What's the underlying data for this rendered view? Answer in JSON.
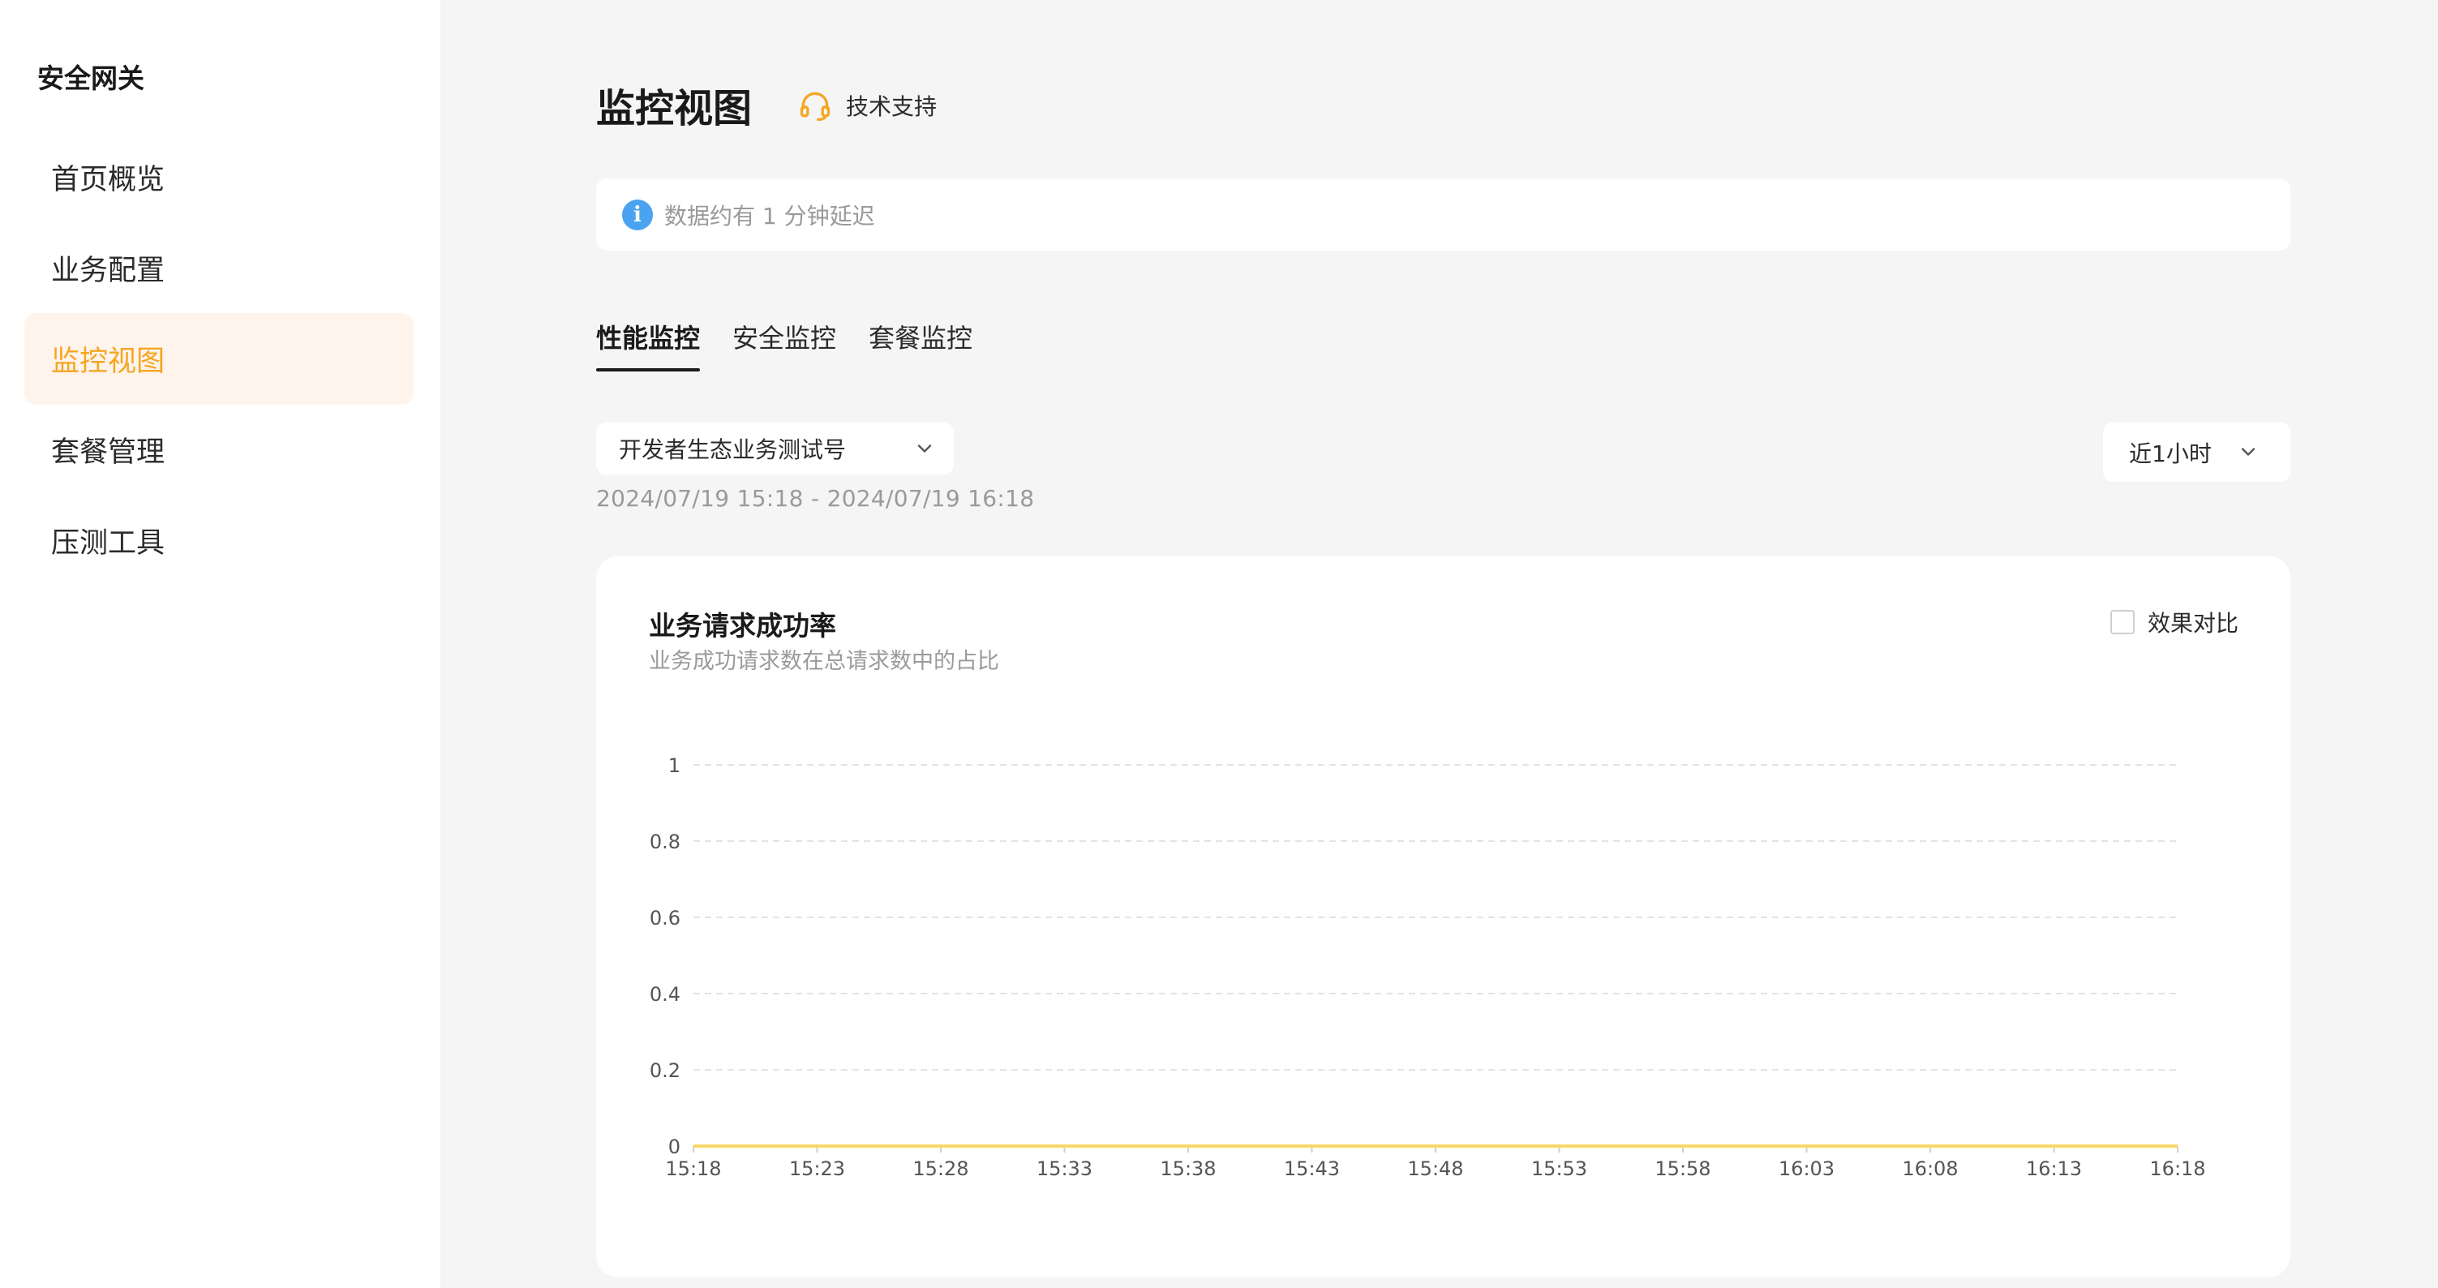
{
  "sidebar": {
    "title": "安全网关",
    "items": [
      {
        "label": "首页概览",
        "active": false
      },
      {
        "label": "业务配置",
        "active": false
      },
      {
        "label": "监控视图",
        "active": true
      },
      {
        "label": "套餐管理",
        "active": false
      },
      {
        "label": "压测工具",
        "active": false
      }
    ]
  },
  "header": {
    "title": "监控视图",
    "support_label": "技术支持",
    "support_icon": "headset-icon"
  },
  "notice": {
    "icon": "info-icon",
    "text": "数据约有 1 分钟延迟"
  },
  "tabs": [
    {
      "label": "性能监控",
      "active": true
    },
    {
      "label": "安全监控",
      "active": false
    },
    {
      "label": "套餐监控",
      "active": false
    }
  ],
  "filters": {
    "account_value": "开发者生态业务测试号",
    "time_range_text": "2024/07/19 15:18 - 2024/07/19 16:18",
    "period_value": "近1小时"
  },
  "card": {
    "title": "业务请求成功率",
    "subtitle": "业务成功请求数在总请求数中的占比",
    "compare_label": "效果对比",
    "compare_checked": false
  },
  "colors": {
    "accent": "#f5a623",
    "active_nav_bg": "#fff4ec",
    "info": "#4aa3f0",
    "series_line": "#f6d96a"
  },
  "chart_data": {
    "type": "line",
    "x": [
      "15:18",
      "15:23",
      "15:28",
      "15:33",
      "15:38",
      "15:43",
      "15:48",
      "15:53",
      "15:58",
      "16:03",
      "16:08",
      "16:13",
      "16:18"
    ],
    "series": [
      {
        "values": [
          0,
          0,
          0,
          0,
          0,
          0,
          0,
          0,
          0,
          0,
          0,
          0,
          0
        ]
      }
    ],
    "y_ticks": [
      "0",
      "0.2",
      "0.4",
      "0.6",
      "0.8",
      "1"
    ],
    "ylim": [
      0,
      1
    ],
    "grid": true
  }
}
